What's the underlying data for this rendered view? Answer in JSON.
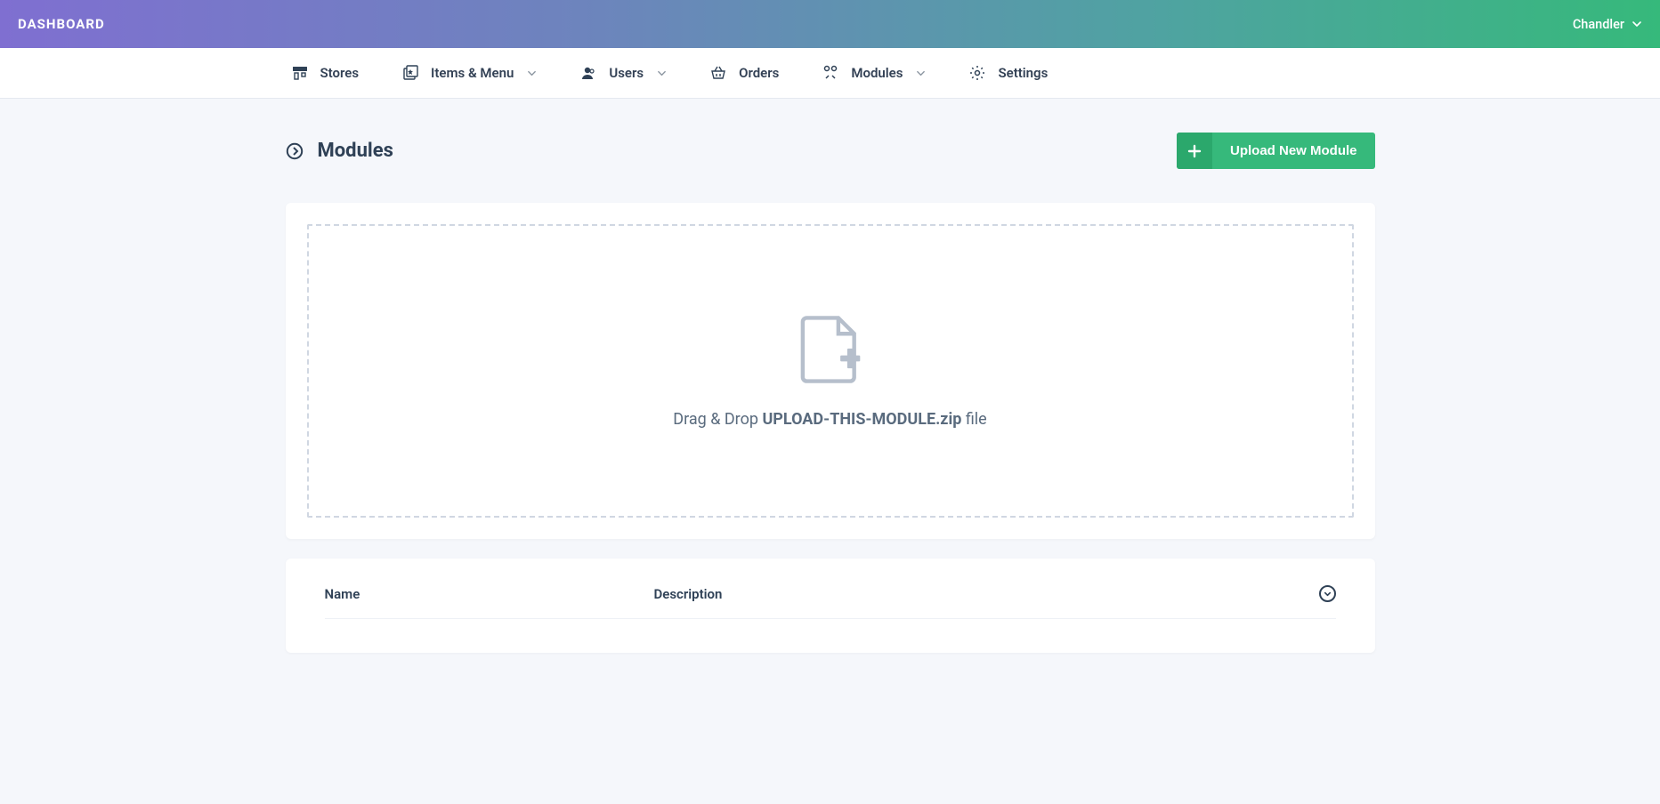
{
  "header": {
    "brand": "DASHBOARD",
    "user": "Chandler"
  },
  "nav": {
    "stores": "Stores",
    "items_menu": "Items & Menu",
    "users": "Users",
    "orders": "Orders",
    "modules": "Modules",
    "settings": "Settings"
  },
  "page": {
    "title": "Modules",
    "upload_button": "Upload New Module",
    "dropzone_prefix": "Drag & Drop ",
    "dropzone_filename": "UPLOAD-THIS-MODULE.zip",
    "dropzone_suffix": " file"
  },
  "table": {
    "col_name": "Name",
    "col_description": "Description"
  }
}
